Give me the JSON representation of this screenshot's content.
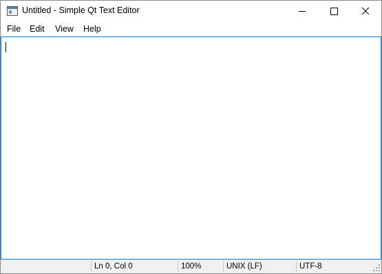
{
  "window": {
    "title": "Untitled - Simple Qt Text Editor",
    "icon": "app-window-icon",
    "controls": {
      "minimize_icon": "minimize-icon",
      "maximize_icon": "maximize-icon",
      "close_icon": "close-icon"
    }
  },
  "menubar": {
    "items": [
      {
        "label": "File"
      },
      {
        "label": "Edit"
      },
      {
        "label": "View"
      },
      {
        "label": "Help"
      }
    ]
  },
  "editor": {
    "content": "",
    "focus_color": "#0b7bd4"
  },
  "statusbar": {
    "position": "Ln 0, Col 0",
    "zoom": "100%",
    "line_ending": "UNIX (LF)",
    "encoding": "UTF-8"
  }
}
